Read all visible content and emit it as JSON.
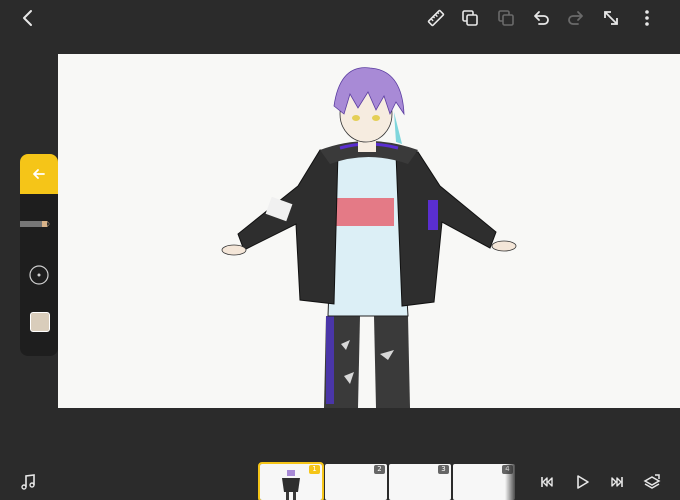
{
  "toolbar": {
    "back": "back-arrow",
    "tools": [
      "ruler-icon",
      "copy-frame-icon",
      "paste-frame-icon",
      "undo-icon",
      "redo-icon",
      "fullscreen-icon",
      "more-icon"
    ]
  },
  "timeline": {
    "frames": [
      {
        "number": "1",
        "active": true
      },
      {
        "number": "2",
        "active": false
      },
      {
        "number": "3",
        "active": false
      },
      {
        "number": "4",
        "active": false
      }
    ]
  },
  "colors": {
    "accent": "#f5c518",
    "background": "#2b2b2b",
    "panel": "#1e1e1e",
    "canvas": "#f8f8f6"
  }
}
